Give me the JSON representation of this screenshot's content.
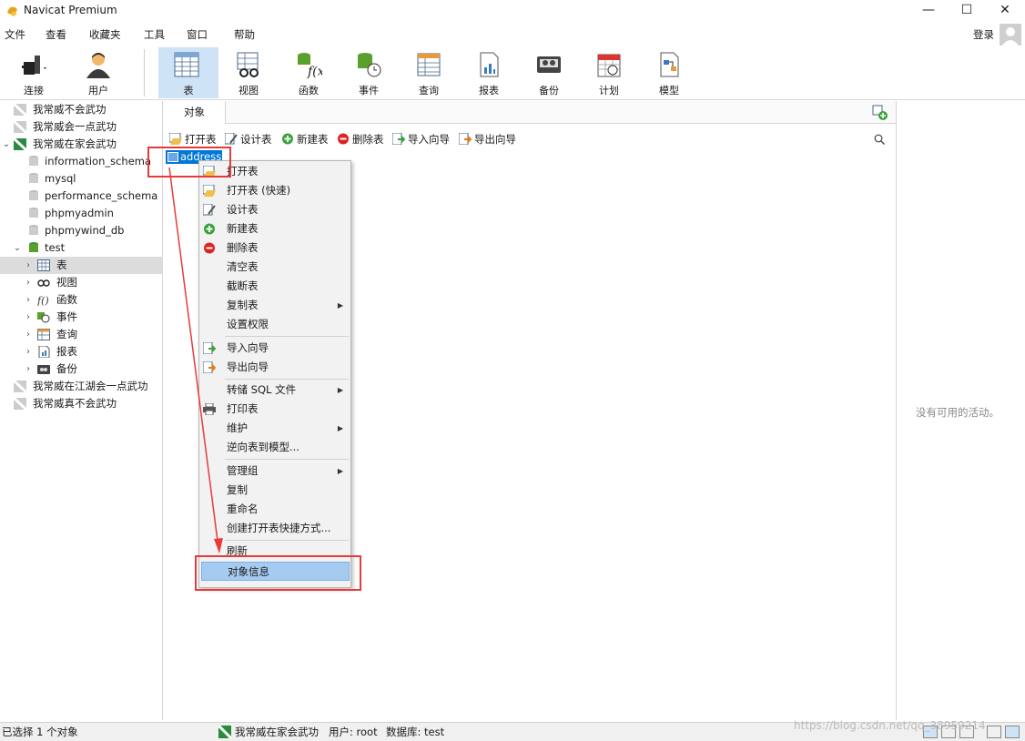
{
  "window": {
    "title": "Navicat Premium",
    "minimize": "—",
    "maximize": "☐",
    "close": "✕"
  },
  "menu": [
    "文件",
    "查看",
    "收藏夹",
    "工具",
    "窗口",
    "帮助"
  ],
  "login": "登录",
  "toolbar": [
    {
      "label": "连接",
      "icon": "connection-icon"
    },
    {
      "label": "用户",
      "icon": "user-icon"
    },
    {
      "label": "表",
      "icon": "table-icon"
    },
    {
      "label": "视图",
      "icon": "view-icon"
    },
    {
      "label": "函数",
      "icon": "function-icon"
    },
    {
      "label": "事件",
      "icon": "event-icon"
    },
    {
      "label": "查询",
      "icon": "query-icon"
    },
    {
      "label": "报表",
      "icon": "report-icon"
    },
    {
      "label": "备份",
      "icon": "backup-icon"
    },
    {
      "label": "计划",
      "icon": "schedule-icon"
    },
    {
      "label": "模型",
      "icon": "model-icon"
    }
  ],
  "tree": [
    "我常威不会武功",
    "我常威会一点武功",
    "我常威在家会武功",
    "information_schema",
    "mysql",
    "performance_schema",
    "phpmyadmin",
    "phpmywind_db",
    "test",
    "表",
    "视图",
    "函数",
    "事件",
    "查询",
    "报表",
    "备份",
    "我常威在江湖会一点武功",
    "我常威真不会武功"
  ],
  "tabs": {
    "objects": "对象"
  },
  "objectToolbar": [
    "打开表",
    "设计表",
    "新建表",
    "删除表",
    "导入向导",
    "导出向导"
  ],
  "selectedObject": "address",
  "contextMenu": [
    "打开表",
    "打开表 (快速)",
    "设计表",
    "新建表",
    "删除表",
    "清空表",
    "截断表",
    "复制表",
    "设置权限",
    "导入向导",
    "导出向导",
    "转储 SQL 文件",
    "打印表",
    "维护",
    "逆向表到模型...",
    "管理组",
    "复制",
    "重命名",
    "创建打开表快捷方式...",
    "刷新",
    "对象信息"
  ],
  "infoPanel": {
    "empty": "没有可用的活动。"
  },
  "status": {
    "selection": "已选择 1 个对象",
    "connection": "我常威在家会武功",
    "user": "用户: root",
    "database": "数据库: test"
  },
  "watermark": "https://blog.csdn.net/qq_38959214",
  "colors": {
    "accent": "#0078d7",
    "highlight": "#a6cbf1",
    "annotation": "#e53b3b"
  }
}
